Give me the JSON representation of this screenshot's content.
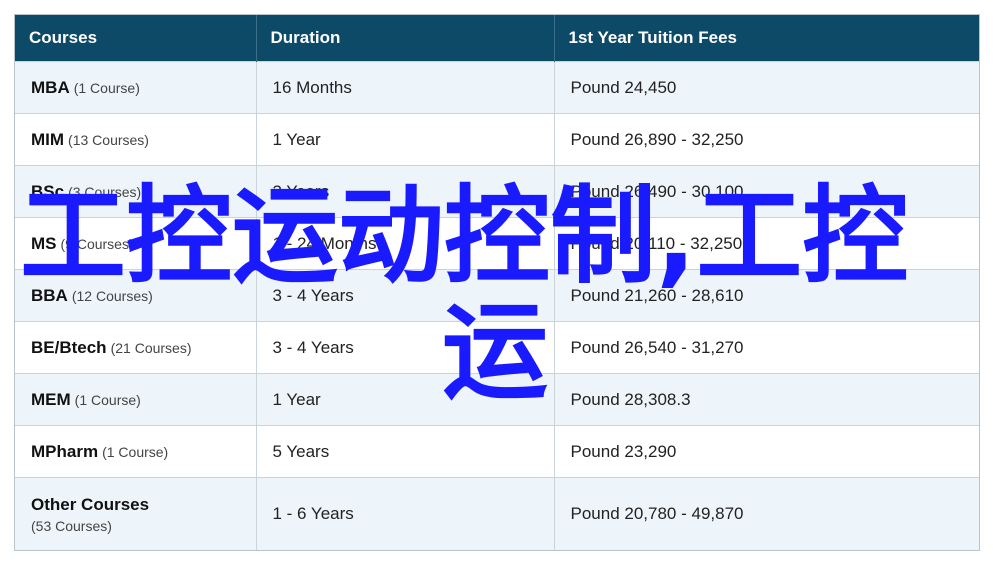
{
  "table": {
    "headers": {
      "courses": "Courses",
      "duration": "Duration",
      "fees": "1st Year Tuition Fees"
    },
    "rows": [
      {
        "name": "MBA",
        "count": "(1 Course)",
        "duration": "16 Months",
        "fees": "Pound 24,450"
      },
      {
        "name": "MIM",
        "count": "(13 Courses)",
        "duration": "1 Year",
        "fees": "Pound 26,890 - 32,250"
      },
      {
        "name": "BSc",
        "count": "(3 Courses)",
        "duration": "3 Years",
        "fees": "Pound 26,490 - 30,100"
      },
      {
        "name": "MS",
        "count": "(9 Courses)",
        "duration": "1 - 24 Months",
        "fees": "Pound 20,110 - 32,250"
      },
      {
        "name": "BBA",
        "count": "(12 Courses)",
        "duration": "3 - 4 Years",
        "fees": "Pound 21,260 - 28,610"
      },
      {
        "name": "BE/Btech",
        "count": "(21 Courses)",
        "duration": "3 - 4 Years",
        "fees": "Pound 26,540 - 31,270"
      },
      {
        "name": "MEM",
        "count": "(1 Course)",
        "duration": "1 Year",
        "fees": "Pound 28,308.3"
      },
      {
        "name": "MPharm",
        "count": "(1 Course)",
        "duration": "5 Years",
        "fees": "Pound 23,290"
      },
      {
        "name": "Other Courses",
        "count": "(53 Courses)",
        "duration": "1 - 6 Years",
        "fees": "Pound 20,780 - 49,870"
      }
    ]
  },
  "overlay": {
    "line1": "工控运动控制,工控",
    "line2": "运",
    "color": "#1a1aff"
  },
  "colors": {
    "header_bg": "#0d4a68",
    "row_alt_bg": "#eef5fa"
  }
}
